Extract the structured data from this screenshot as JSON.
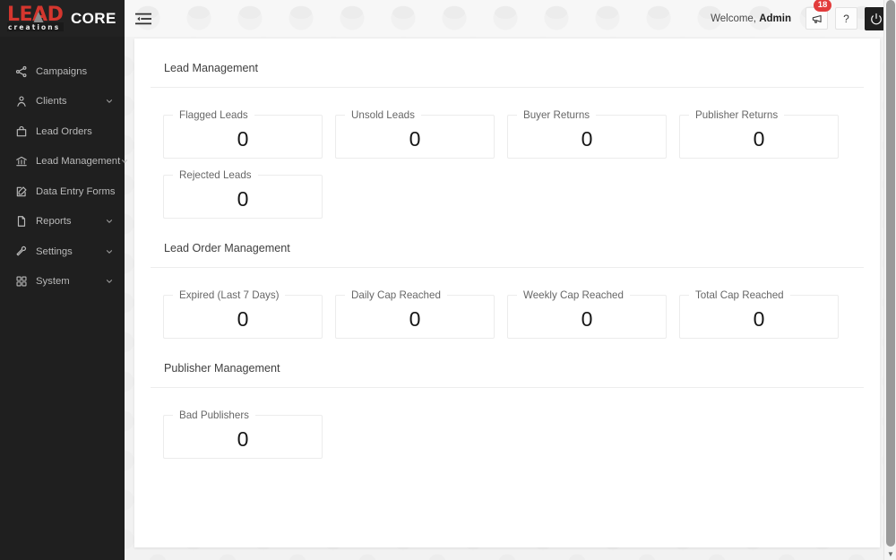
{
  "brand": {
    "logo_text": "LEAD",
    "logo_subtext": "creations",
    "product": "CORE",
    "logo_color": "#d4362e"
  },
  "header": {
    "menu_icon": "menu-fold-icon",
    "welcome_prefix": "Welcome,",
    "welcome_user": "Admin",
    "announcement_icon": "megaphone-icon",
    "announcement_badge": "18",
    "badge_color": "#e23c3c",
    "help_label": "?",
    "power_icon": "power-icon"
  },
  "sidebar": {
    "items": [
      {
        "label": "Campaigns",
        "icon": "share-nodes-icon",
        "expandable": false
      },
      {
        "label": "Clients",
        "icon": "user-icon",
        "expandable": true
      },
      {
        "label": "Lead Orders",
        "icon": "bag-icon",
        "expandable": false
      },
      {
        "label": "Lead Management",
        "icon": "bank-icon",
        "expandable": true
      },
      {
        "label": "Data Entry Forms",
        "icon": "form-edit-icon",
        "expandable": false
      },
      {
        "label": "Reports",
        "icon": "file-icon",
        "expandable": true
      },
      {
        "label": "Settings",
        "icon": "wrench-icon",
        "expandable": true
      },
      {
        "label": "System",
        "icon": "grid-apps-icon",
        "expandable": true
      }
    ]
  },
  "main": {
    "sections": [
      {
        "title": "Lead Management",
        "rows": [
          [
            {
              "label": "Flagged Leads",
              "value": "0"
            },
            {
              "label": "Unsold Leads",
              "value": "0"
            },
            {
              "label": "Buyer Returns",
              "value": "0"
            },
            {
              "label": "Publisher Returns",
              "value": "0"
            }
          ],
          [
            {
              "label": "Rejected Leads",
              "value": "0"
            }
          ]
        ]
      },
      {
        "title": "Lead Order Management",
        "rows": [
          [
            {
              "label": "Expired (Last 7 Days)",
              "value": "0"
            },
            {
              "label": "Daily Cap Reached",
              "value": "0"
            },
            {
              "label": "Weekly Cap Reached",
              "value": "0"
            },
            {
              "label": "Total Cap Reached",
              "value": "0"
            }
          ]
        ]
      },
      {
        "title": "Publisher Management",
        "rows": [
          [
            {
              "label": "Bad Publishers",
              "value": "0"
            }
          ]
        ]
      }
    ]
  },
  "scrollbar": {
    "up_arrow": "▲",
    "down_arrow": "▼"
  }
}
